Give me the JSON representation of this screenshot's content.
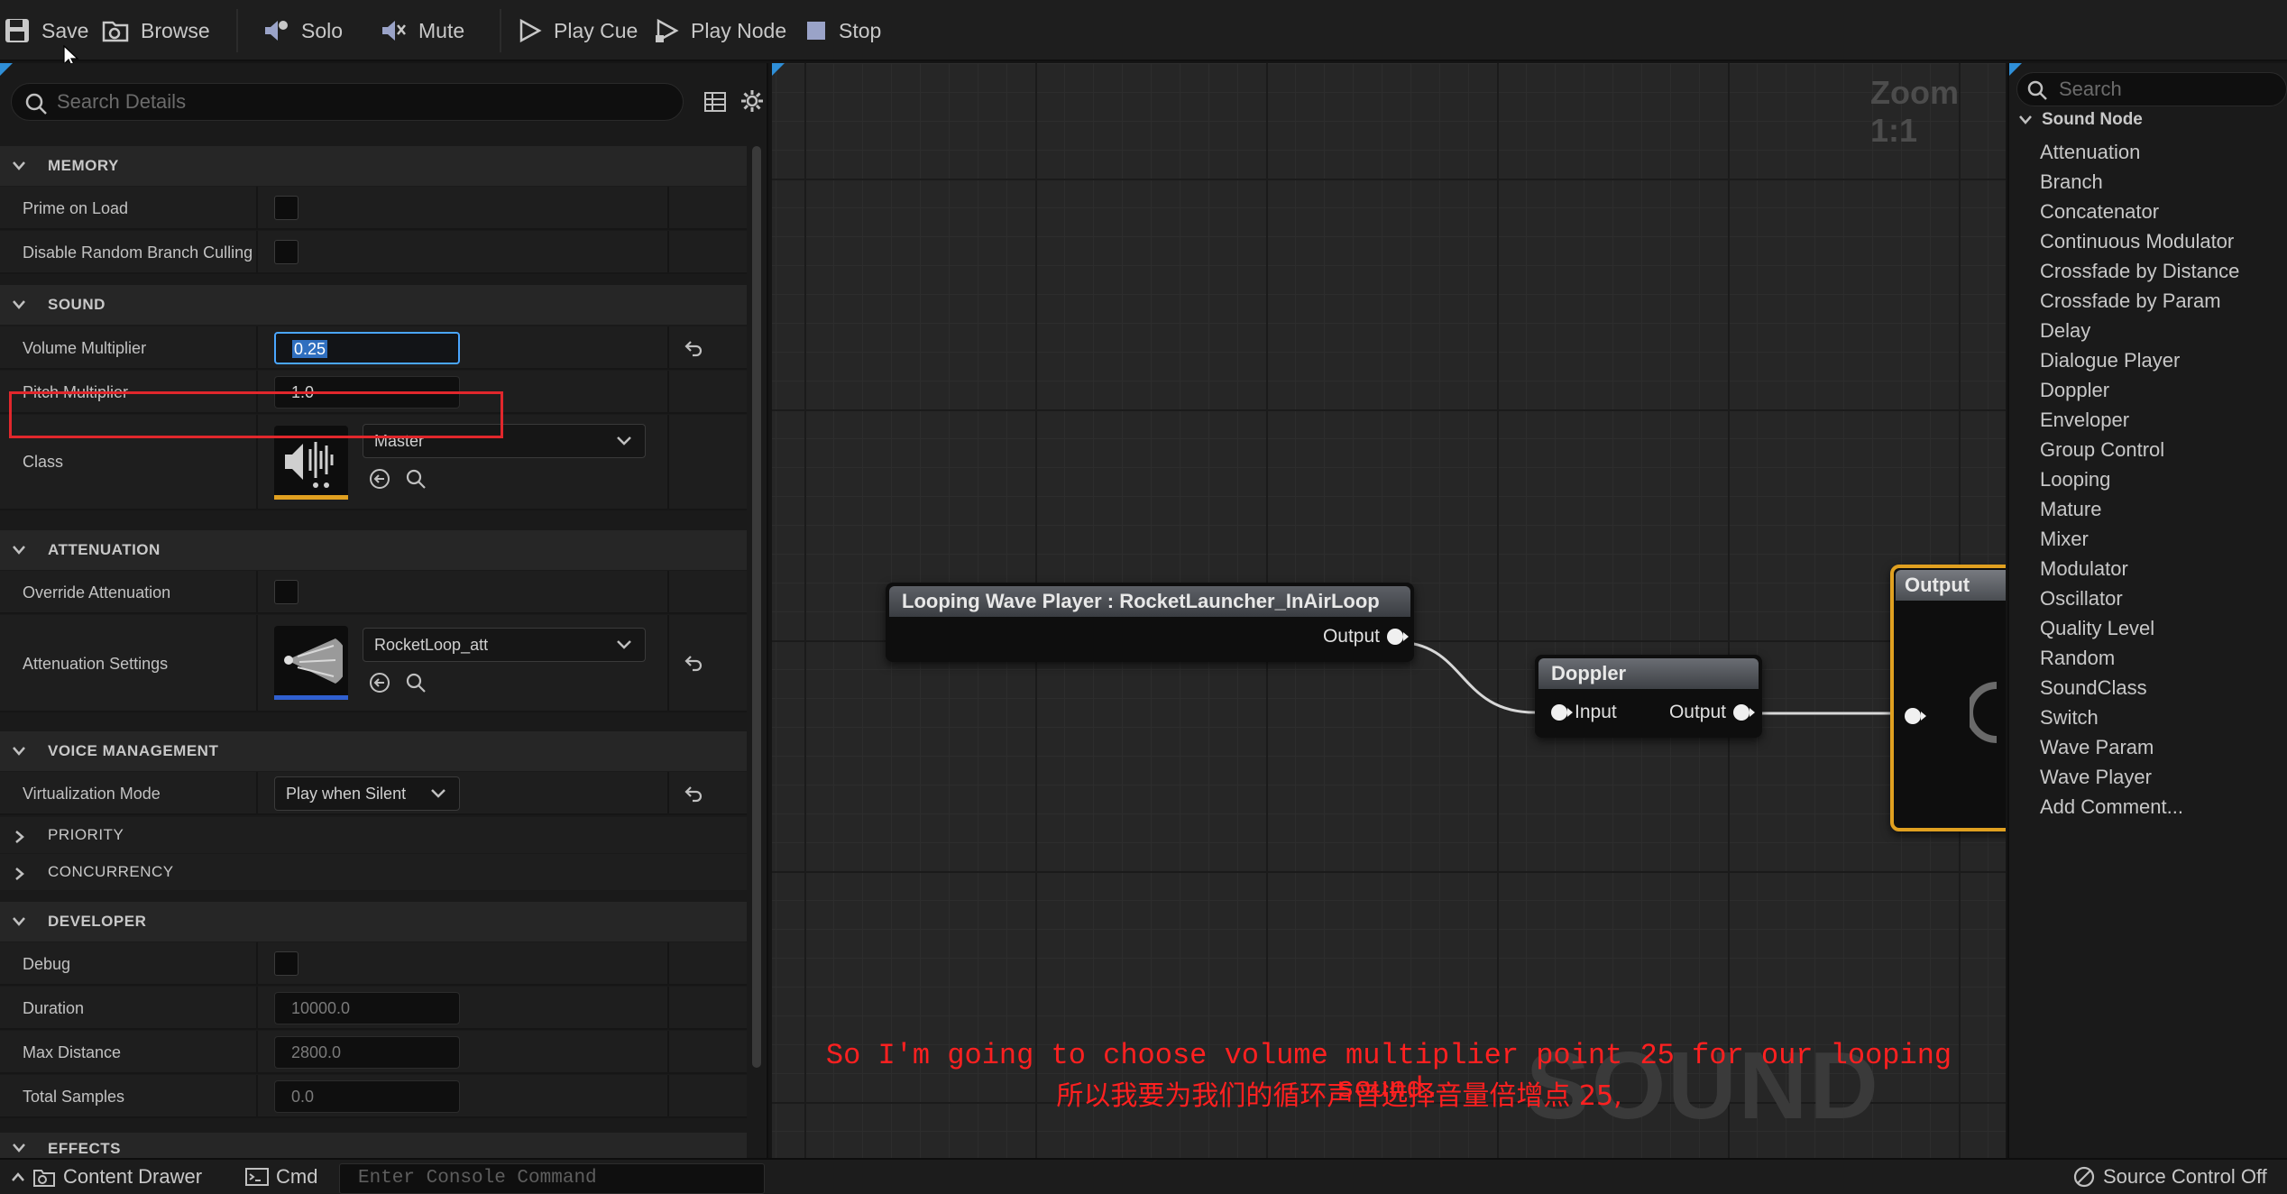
{
  "toolbar": {
    "save": "Save",
    "browse": "Browse",
    "solo": "Solo",
    "mute": "Mute",
    "play_cue": "Play Cue",
    "play_node": "Play Node",
    "stop": "Stop"
  },
  "details": {
    "search_placeholder": "Search Details",
    "categories": {
      "memory": "MEMORY",
      "sound": "SOUND",
      "attenuation": "ATTENUATION",
      "voice": "VOICE MANAGEMENT",
      "priority": "PRIORITY",
      "concurrency": "CONCURRENCY",
      "developer": "DEVELOPER",
      "effects": "EFFECTS"
    },
    "memory": {
      "prime_on_load": "Prime on Load",
      "disable_culling": "Disable Random Branch Culling"
    },
    "sound": {
      "volume_label": "Volume Multiplier",
      "volume_value": "0.25",
      "pitch_label": "Pitch Multiplier",
      "pitch_value": "1.0",
      "class_label": "Class",
      "class_value": "Master"
    },
    "attenuation": {
      "override_label": "Override Attenuation",
      "settings_label": "Attenuation Settings",
      "settings_value": "RocketLoop_att"
    },
    "voice": {
      "virtualization_label": "Virtualization Mode",
      "virtualization_value": "Play when Silent"
    },
    "developer": {
      "debug_label": "Debug",
      "duration_label": "Duration",
      "duration_value": "10000.0",
      "max_distance_label": "Max Distance",
      "max_distance_value": "2800.0",
      "total_samples_label": "Total Samples",
      "total_samples_value": "0.0"
    }
  },
  "graph": {
    "zoom": "Zoom 1:1",
    "watermark": "SOUND CUE",
    "nodes": {
      "wave_player": {
        "title": "Looping Wave Player : RocketLauncher_InAirLoop",
        "output": "Output"
      },
      "doppler": {
        "title": "Doppler",
        "input": "Input",
        "output": "Output"
      },
      "output": {
        "title": "Output"
      }
    },
    "subtitle_en": "So I'm going to choose volume multiplier point 25 for our looping sound.",
    "subtitle_zh": "所以我要为我们的循环声音选择音量倍增点 25,"
  },
  "palette": {
    "search_placeholder": "Search",
    "category": "Sound Node",
    "items": [
      "Attenuation",
      "Branch",
      "Concatenator",
      "Continuous Modulator",
      "Crossfade by Distance",
      "Crossfade by Param",
      "Delay",
      "Dialogue Player",
      "Doppler",
      "Enveloper",
      "Group Control",
      "Looping",
      "Mature",
      "Mixer",
      "Modulator",
      "Oscillator",
      "Quality Level",
      "Random",
      "SoundClass",
      "Switch",
      "Wave Param",
      "Wave Player",
      "Add Comment..."
    ]
  },
  "statusbar": {
    "content_drawer": "Content Drawer",
    "cmd": "Cmd",
    "console_placeholder": "Enter Console Command",
    "source_control": "Source Control Off"
  },
  "colors": {
    "accent": "#2f8fd8",
    "output_node_border": "#e0a020",
    "highlight_box": "#e1272c",
    "subtitle": "#ff2020",
    "class_thumb_bar": "#e0a020",
    "attenuation_thumb_bar": "#3060d0"
  }
}
